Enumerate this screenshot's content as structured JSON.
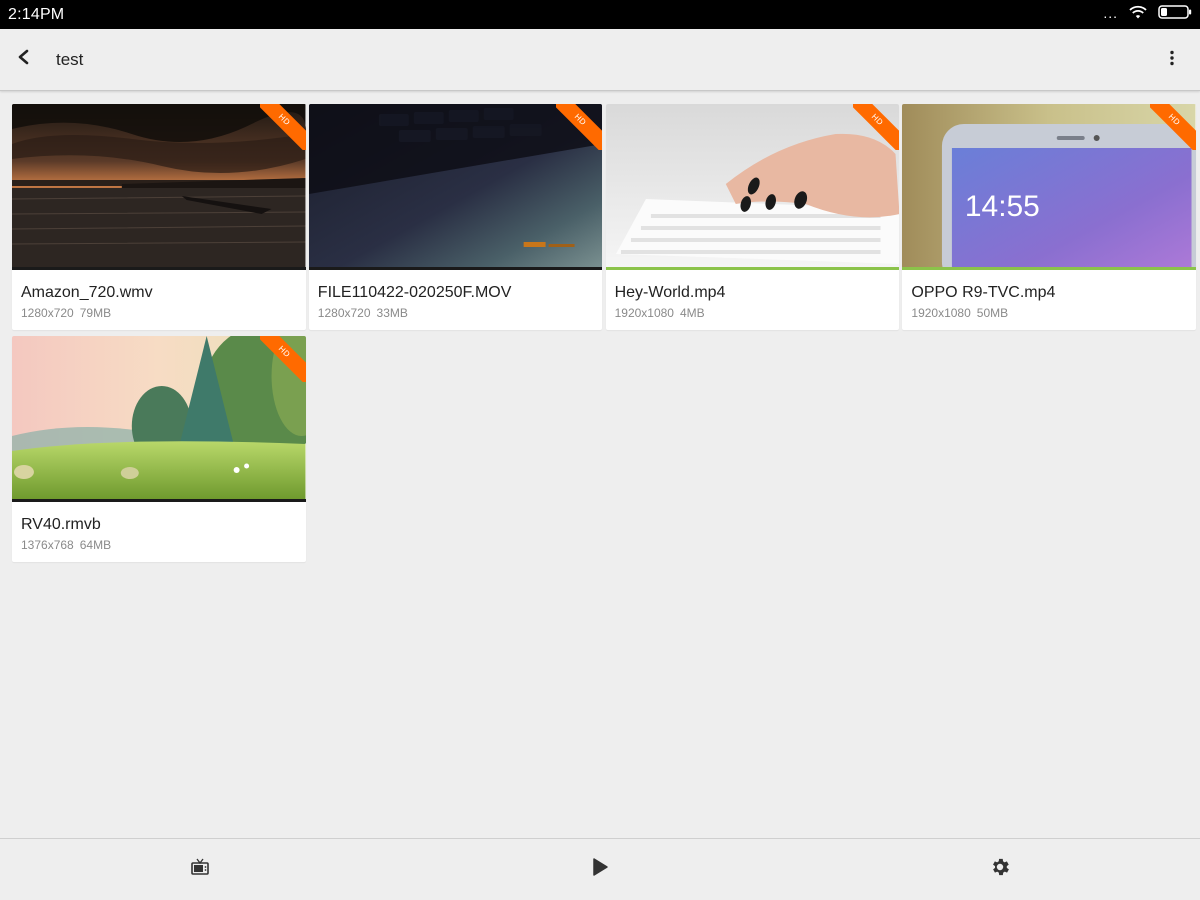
{
  "status_bar": {
    "time": "2:14PM",
    "dots": "...",
    "icons": [
      "wifi-icon",
      "battery-icon"
    ]
  },
  "app_bar": {
    "title": "test",
    "icons": [
      "back-arrow-icon",
      "overflow-menu-icon"
    ]
  },
  "badge": "HD",
  "videos": [
    {
      "title": "Amazon_720.wmv",
      "resolution": "1280x720",
      "size": "79MB",
      "progress": 0,
      "hd": true
    },
    {
      "title": "FILE110422-020250F.MOV",
      "resolution": "1280x720",
      "size": "33MB",
      "progress": 0,
      "hd": true
    },
    {
      "title": "Hey-World.mp4",
      "resolution": "1920x1080",
      "size": "4MB",
      "progress": 1.0,
      "hd": true
    },
    {
      "title": "OPPO R9-TVC.mp4",
      "resolution": "1920x1080",
      "size": "50MB",
      "progress": 1.0,
      "hd": true
    },
    {
      "title": "RV40.rmvb",
      "resolution": "1376x768",
      "size": "64MB",
      "progress": 0,
      "hd": true
    }
  ],
  "thumbnail_text": {
    "phone_clock": "14:55"
  },
  "bottom_nav": {
    "icons": [
      "tv-icon",
      "play-icon",
      "settings-gear-icon"
    ]
  },
  "colors": {
    "accent_progress": "#8bc34a",
    "hd_badge": "#ff6a00",
    "status_bar": "#000000",
    "background": "#eeeeee"
  }
}
